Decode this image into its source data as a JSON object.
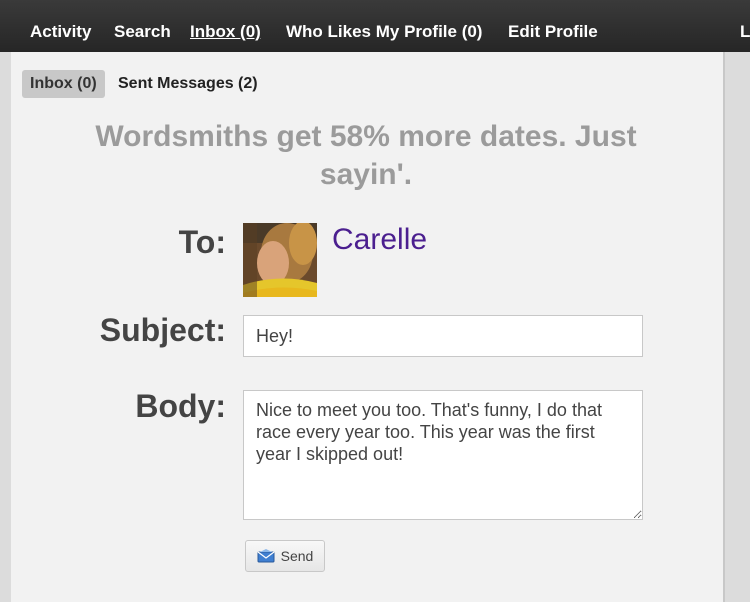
{
  "nav": {
    "items": [
      {
        "label": "Activity"
      },
      {
        "label": "Search"
      },
      {
        "label": "Inbox (0)"
      },
      {
        "label": "Who Likes My Profile (0)"
      },
      {
        "label": "Edit Profile"
      }
    ],
    "overflow_label": "L"
  },
  "subtabs": {
    "inbox": "Inbox (0)",
    "sent": "Sent Messages (2)"
  },
  "headline": "Wordsmiths get 58% more dates. Just sayin'.",
  "compose": {
    "to_label": "To:",
    "recipient_name": "Carelle",
    "subject_label": "Subject:",
    "subject_value": "Hey!",
    "body_label": "Body:",
    "body_value": "Nice to meet you too. That's funny, I do that race every year too. This year was the first year I skipped out!",
    "send_label": "Send",
    "send_icon": "envelope-icon"
  },
  "colors": {
    "nav_bg": "#2e2e2e",
    "headline": "#9b9b9b",
    "recipient_link": "#4b1f8f"
  }
}
